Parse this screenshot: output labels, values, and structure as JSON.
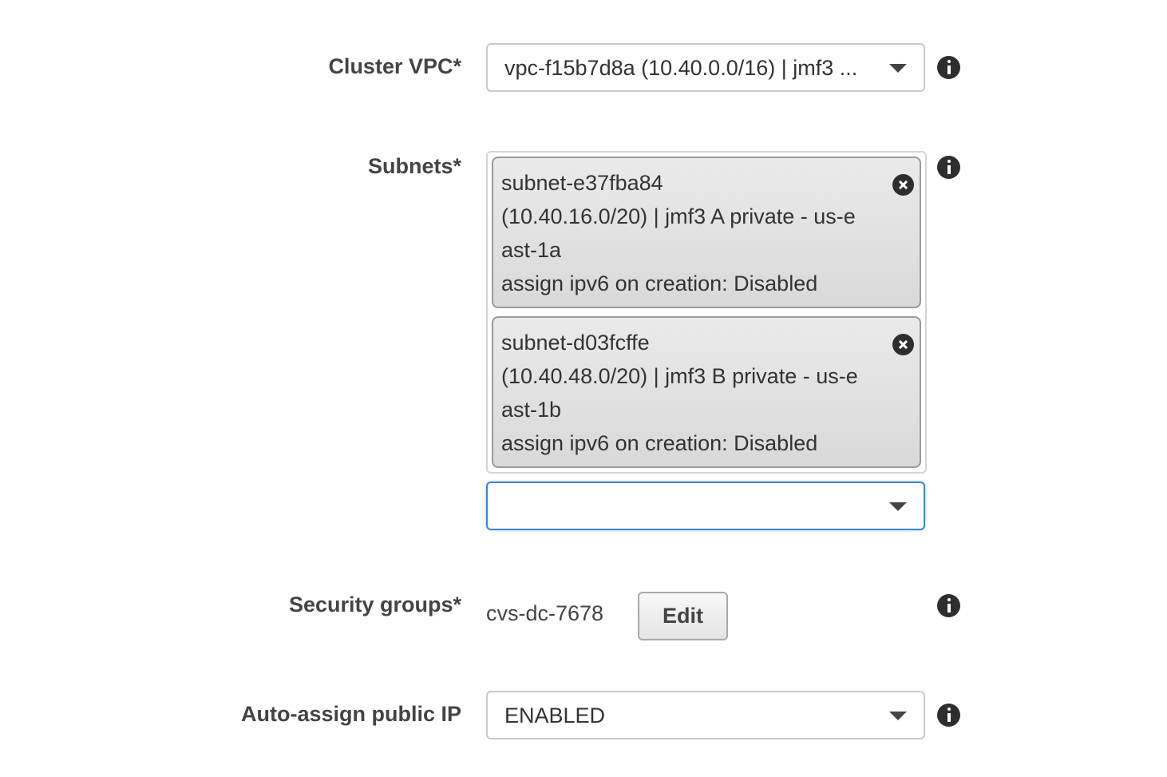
{
  "form": {
    "cluster_vpc": {
      "label": "Cluster VPC*",
      "selected": "vpc-f15b7d8a (10.40.0.0/16) | jmf3 ..."
    },
    "subnets": {
      "label": "Subnets*",
      "selected_items": [
        {
          "text": "subnet-e37fba84 (10.40.16.0/20) | jmf3 A private - us-east-1a assign ipv6 on creation: Disabled",
          "line1": "subnet-e37fba84",
          "line2": "(10.40.16.0/20) | jmf3 A private - us-e",
          "line3": "ast-1a",
          "line4": "assign ipv6 on creation: Disabled"
        },
        {
          "text": "subnet-d03fcffe (10.40.48.0/20) | jmf3 B private - us-east-1b assign ipv6 on creation: Disabled",
          "line1": "subnet-d03fcffe",
          "line2": "(10.40.48.0/20) | jmf3 B private - us-e",
          "line3": "ast-1b",
          "line4": "assign ipv6 on creation: Disabled"
        }
      ],
      "add_select_value": ""
    },
    "security_groups": {
      "label": "Security groups*",
      "value": "cvs-dc-7678",
      "edit_label": "Edit"
    },
    "auto_assign_public_ip": {
      "label": "Auto-assign public IP",
      "selected": "ENABLED"
    }
  },
  "icons": {
    "info": "info-icon",
    "dropdown": "chevron-down-icon",
    "remove": "close-circle-icon"
  },
  "colors": {
    "focus_border": "#3a86d6",
    "token_bg": "#dedede",
    "label_text": "#444444"
  }
}
